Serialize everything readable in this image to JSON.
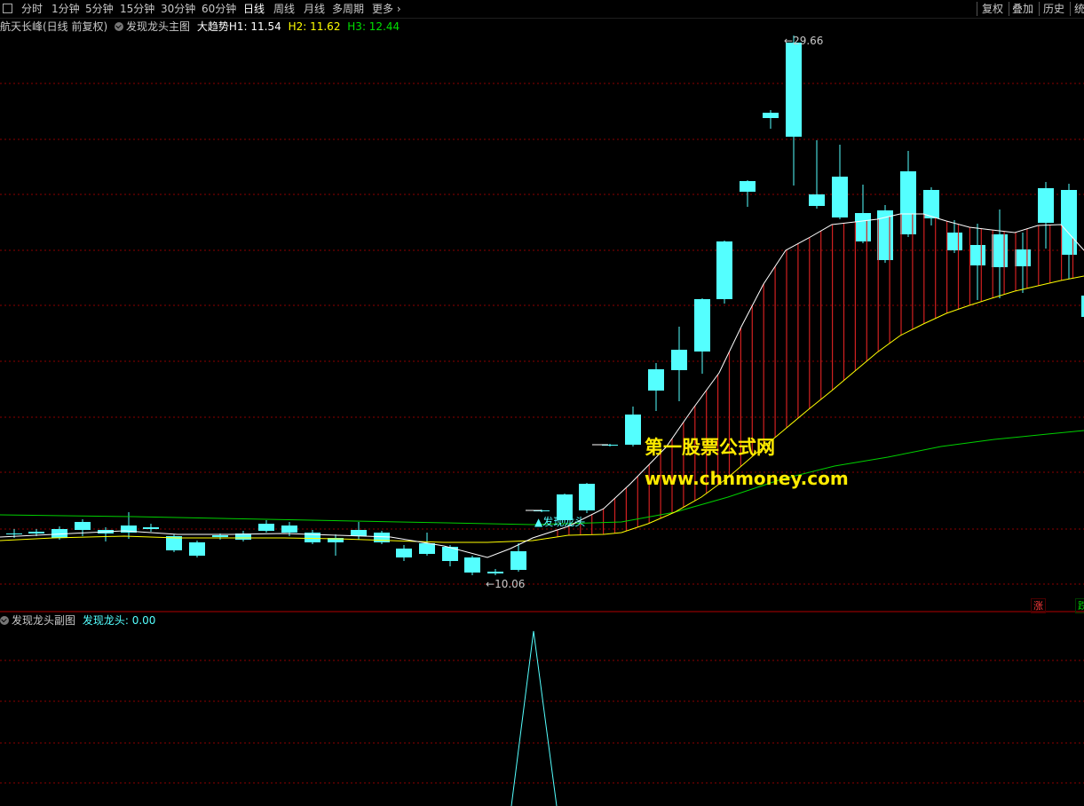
{
  "toolbar": {
    "items": [
      "分时",
      "1分钟",
      "5分钟",
      "15分钟",
      "30分钟",
      "60分钟",
      "日线",
      "周线",
      "月线",
      "多周期",
      "更多"
    ],
    "active": "日线",
    "right": [
      "复权",
      "叠加",
      "历史",
      "统"
    ]
  },
  "main_info": {
    "stock": "航天长峰(日线 前复权)",
    "indicator": "发现龙头主图",
    "trend_label": "大趋势",
    "h1": "H1: 11.54",
    "h2": "H2: 11.62",
    "h3": "H3: 12.44",
    "colors": {
      "h1": "#ffffff",
      "h2": "#ffff00",
      "h3": "#00e000"
    }
  },
  "annotations": {
    "high": "29.66",
    "low": "10.06",
    "signal": "▲发现龙头"
  },
  "watermark": {
    "line1": "第一股票公式网",
    "line2": "www.chnmoney.com"
  },
  "side_tags": {
    "up": "涨",
    "down": "跌"
  },
  "sub_info": {
    "indicator": "发现龙头副图",
    "value_label": "发现龙头: 0.00"
  },
  "colors": {
    "up": "#ff3c3c",
    "down": "#54ffff",
    "grid": "#8b0000",
    "ma_white": "#ffffff",
    "ma_yellow": "#ffff00",
    "ma_green": "#00d000",
    "sub_line": "#54ffff"
  }
}
